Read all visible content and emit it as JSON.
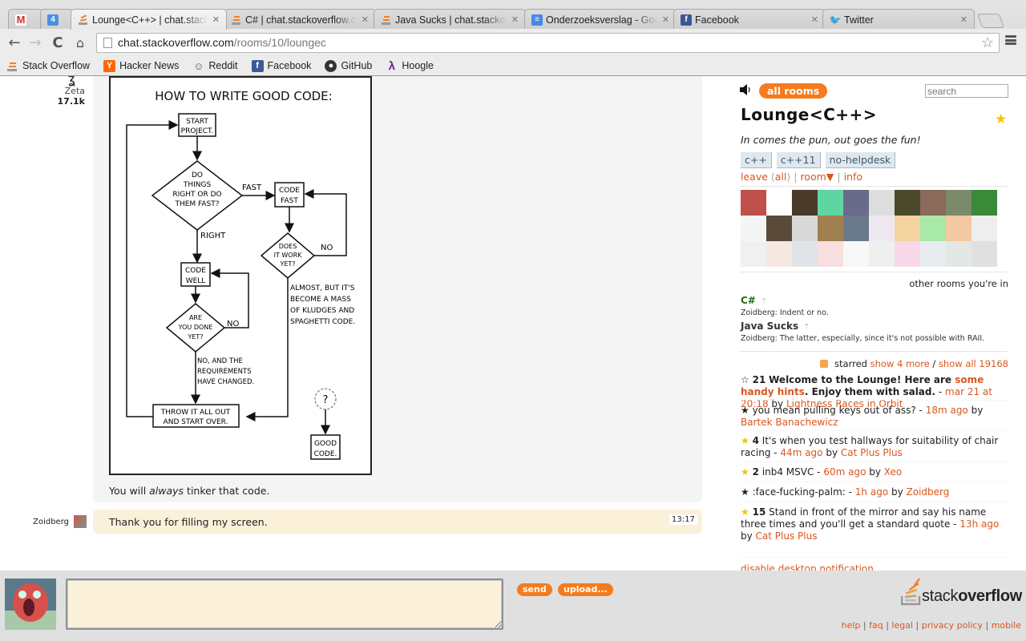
{
  "browser": {
    "tabs": [
      {
        "label": "",
        "icon": "gmail-icon",
        "active": false
      },
      {
        "label": "",
        "icon": "calendar-icon",
        "badge": "4",
        "active": false
      },
      {
        "label": "Lounge<C++> | chat.stackoverflow.com",
        "icon": "stackoverflow-icon",
        "active": true
      },
      {
        "label": "C# | chat.stackoverflow.com",
        "icon": "stackoverflow-icon",
        "active": false
      },
      {
        "label": "Java Sucks | chat.stackoverflow.com",
        "icon": "stackoverflow-icon",
        "active": false
      },
      {
        "label": "Onderzoeksverslag - Google Docs",
        "icon": "google-docs-icon",
        "active": false
      },
      {
        "label": "Facebook",
        "icon": "facebook-icon",
        "active": false
      },
      {
        "label": "Twitter",
        "icon": "twitter-icon",
        "active": false
      }
    ],
    "url_host": "chat.stackoverflow.com",
    "url_path": "/rooms/10/loungec",
    "bookmarks": [
      {
        "label": "Stack Overflow",
        "icon": "stackoverflow-icon"
      },
      {
        "label": "Hacker News",
        "icon": "hackernews-icon"
      },
      {
        "label": "Reddit",
        "icon": "reddit-icon"
      },
      {
        "label": "Facebook",
        "icon": "facebook-icon"
      },
      {
        "label": "GitHub",
        "icon": "github-icon"
      },
      {
        "label": "Hoogle",
        "icon": "lambda-icon"
      }
    ]
  },
  "chat": {
    "prev_user": {
      "name": "Zeta",
      "avatar_glyph": "ʓ",
      "reputation": "17.1k"
    },
    "comic": {
      "title": "HOW TO WRITE GOOD CODE:",
      "nodes": {
        "start": "START PROJECT.",
        "decision1": "DO THINGS RIGHT OR DO THEM FAST?",
        "fast_label": "FAST",
        "right_label": "RIGHT",
        "code_fast": "CODE FAST",
        "does_it_work": "DOES IT WORK YET?",
        "no1": "NO",
        "almost": "ALMOST, BUT IT'S BECOME A MASS OF KLUDGES AND SPAGHETTI CODE.",
        "code_well": "CODE WELL",
        "are_you_done": "ARE YOU DONE YET?",
        "no2": "NO",
        "no_req": "NO, AND THE REQUIREMENTS HAVE CHANGED.",
        "throw": "THROW IT ALL OUT AND START OVER.",
        "question": "?",
        "good_code": "GOOD CODE."
      }
    },
    "prev_message_pre": "You will ",
    "prev_message_em": "always",
    "prev_message_post": " tinker that code.",
    "my_user": {
      "name": "Zoidberg"
    },
    "my_message": "Thank you for filling my screen.",
    "my_message_time": "13:17"
  },
  "sidebar": {
    "all_rooms_label": "all rooms",
    "search_placeholder": "search",
    "room_title": "Lounge<C++>",
    "room_description": "In comes the pun, out goes the fun!",
    "tags": [
      "c++",
      "c++11",
      "no-helpdesk"
    ],
    "links": {
      "leave": "leave",
      "all": "all",
      "room": "room▼",
      "info": "info"
    },
    "avatar_colors": [
      "#c0504a",
      "#ffffff",
      "#4a3a2a",
      "#5fd6a2",
      "#6a6a8a",
      "#dddddd",
      "#4a4a2a",
      "#8a6a5a",
      "#7a8a6a",
      "#3a8a3a",
      "#f5f5f5",
      "#5a4a3a",
      "#d8d8d8",
      "#a08050",
      "#6a7a8a",
      "#f0e8f0",
      "#f4d4a0",
      "#a8e8a8",
      "#f4c8a0",
      "#eeeeee",
      "#f0f0f0",
      "#f4e8e0",
      "#e0e4e8",
      "#f8e0e0",
      "#f8f8f8",
      "#eef0ee",
      "#f8d8e8",
      "#e8ecf0",
      "#e4e8e4",
      "#e0e0e0"
    ],
    "other_rooms_heading": "other rooms you're in",
    "other_rooms": [
      {
        "name": "C#",
        "color": "#236b0f",
        "last": "Zoidberg: Indent or no."
      },
      {
        "name": "Java Sucks",
        "color": "#333333",
        "last": "Zoidberg: The latter, especially, since it's not possible with RAII."
      }
    ],
    "starred_heading": "starred",
    "show_more": "show 4 more",
    "show_all": "show all 19168",
    "starred": [
      {
        "star": "☆",
        "count": "21",
        "bold": true,
        "text_pre": "Welcome to the Lounge! Here are ",
        "link": "some handy hints",
        "text_post": ". Enjoy them with salad.",
        "time": "mar 21 at 20:18",
        "by": "Lightness Races in Orbit"
      },
      {
        "star": "★",
        "count": "",
        "bold": false,
        "text_pre": "you mean pulling keys out of ass?",
        "link": "",
        "text_post": "",
        "time": "18m ago",
        "by": "Bartek Banachewicz"
      },
      {
        "star": "★",
        "yellow": true,
        "count": "4",
        "bold": false,
        "text_pre": "It's when you test hallways for suitability of chair racing",
        "link": "",
        "text_post": "",
        "time": "44m ago",
        "by": "Cat Plus Plus"
      },
      {
        "star": "★",
        "yellow": true,
        "count": "2",
        "bold": false,
        "text_pre": "inb4 MSVC",
        "link": "",
        "text_post": "",
        "time": "60m ago",
        "by": "Xeo"
      },
      {
        "star": "★",
        "count": "",
        "bold": false,
        "text_pre": ":face-fucking-palm:",
        "link": "",
        "text_post": "",
        "time": "1h ago",
        "by": "Zoidberg"
      },
      {
        "star": "★",
        "yellow": true,
        "count": "15",
        "bold": false,
        "text_pre": "Stand in front of the mirror and say his name three times and you'll get a standard quote",
        "link": "",
        "text_post": "",
        "time": "13h ago",
        "by": "Cat Plus Plus"
      }
    ],
    "disable_notification": "disable desktop notification"
  },
  "input": {
    "value": "",
    "send_label": "send",
    "upload_label": "upload..."
  },
  "footer": {
    "logo_text_light": "stack",
    "logo_text_bold": "overflow",
    "links": [
      "help",
      "faq",
      "legal",
      "privacy policy",
      "mobile"
    ]
  },
  "colors": {
    "accent": "#f47c1e",
    "link": "#d9571f",
    "my_message_bg": "#fbf0da",
    "message_bg": "#f4f4f4",
    "star": "#f4c400"
  }
}
